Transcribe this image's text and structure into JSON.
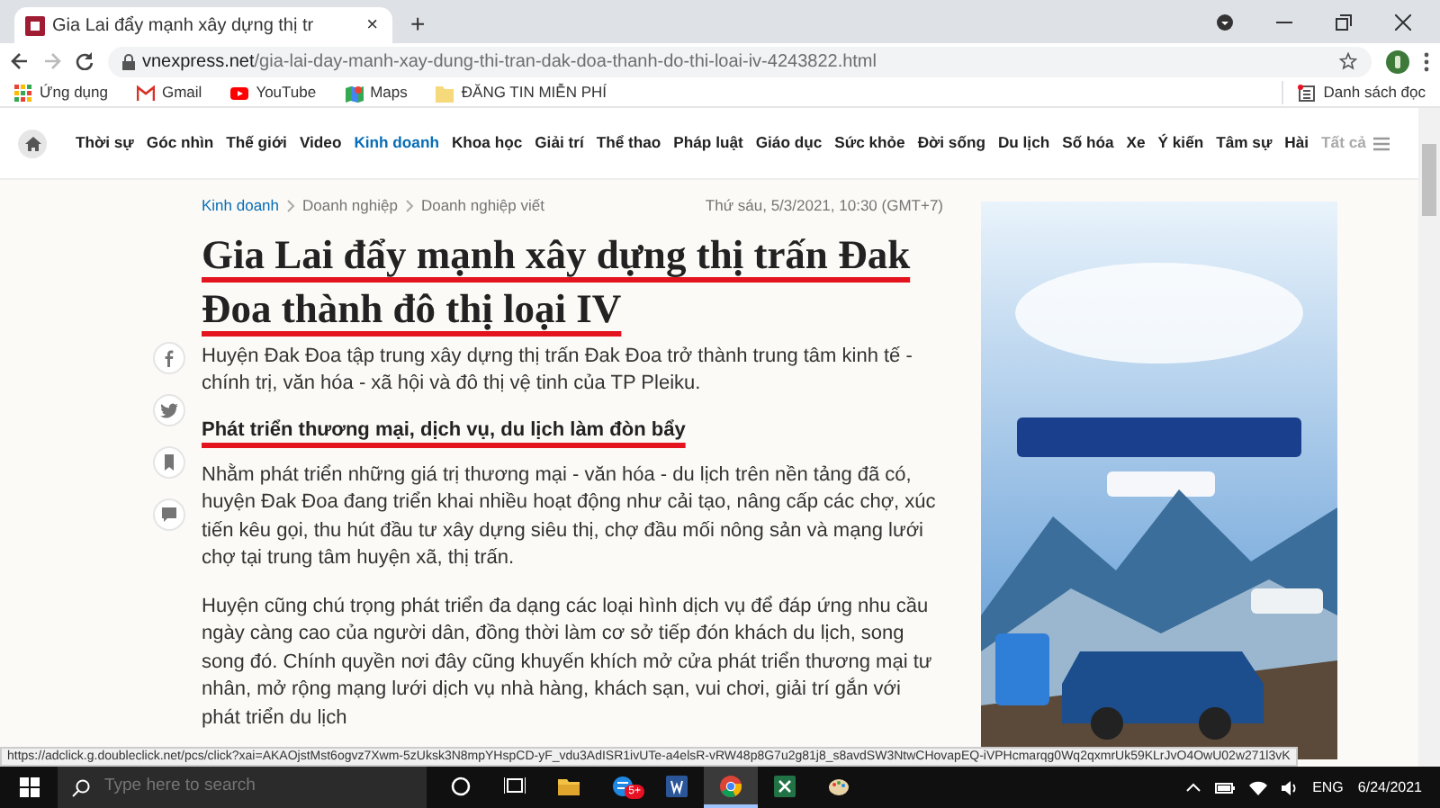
{
  "browser": {
    "tab": {
      "title": "Gia Lai đẩy mạnh xây dựng thị tr",
      "close": "×"
    },
    "new_tab": "+",
    "address": {
      "host": "vnexpress.net",
      "path": "/gia-lai-day-manh-xay-dung-thi-tran-dak-doa-thanh-do-thi-loai-iv-4243822.html"
    },
    "bookmarks": [
      {
        "label": "Ứng dụng",
        "kind": "apps"
      },
      {
        "label": "Gmail",
        "kind": "gmail"
      },
      {
        "label": "YouTube",
        "kind": "youtube"
      },
      {
        "label": "Maps",
        "kind": "maps"
      },
      {
        "label": "ĐĂNG TIN MIỄN PHÍ",
        "kind": "folder"
      }
    ],
    "reading_list": "Danh sách đọc"
  },
  "nav": {
    "items": [
      {
        "label": "Thời sự",
        "selected": false
      },
      {
        "label": "Góc nhìn",
        "selected": false
      },
      {
        "label": "Thế giới",
        "selected": false
      },
      {
        "label": "Video",
        "selected": false
      },
      {
        "label": "Kinh doanh",
        "selected": true
      },
      {
        "label": "Khoa học",
        "selected": false
      },
      {
        "label": "Giải trí",
        "selected": false
      },
      {
        "label": "Thể thao",
        "selected": false
      },
      {
        "label": "Pháp luật",
        "selected": false
      },
      {
        "label": "Giáo dục",
        "selected": false
      },
      {
        "label": "Sức khỏe",
        "selected": false
      },
      {
        "label": "Đời sống",
        "selected": false
      },
      {
        "label": "Du lịch",
        "selected": false
      },
      {
        "label": "Số hóa",
        "selected": false
      },
      {
        "label": "Xe",
        "selected": false
      },
      {
        "label": "Ý kiến",
        "selected": false
      },
      {
        "label": "Tâm sự",
        "selected": false
      },
      {
        "label": "Hài",
        "selected": false
      }
    ],
    "more": "Tất cả"
  },
  "article": {
    "breadcrumbs": [
      "Kinh doanh",
      "Doanh nghiệp",
      "Doanh nghiệp viết"
    ],
    "date": "Thứ sáu, 5/3/2021, 10:30 (GMT+7)",
    "title": "Gia Lai đẩy mạnh xây dựng thị trấn Đak Đoa thành đô thị loại IV",
    "title_annotated": true,
    "summary": "Huyện Đak Đoa tập trung xây dựng thị trấn Đak Đoa trở thành trung tâm kinh tế - chính trị, văn hóa - xã hội và đô thị vệ tinh của TP Pleiku.",
    "sections": [
      {
        "kind": "heading",
        "text": "Phát triển thương mại, dịch vụ, du lịch làm đòn bẩy",
        "annotated": true
      },
      {
        "kind": "paragraph",
        "text": "Nhằm phát triển những giá trị thương mại - văn hóa - du lịch trên nền tảng đã có, huyện Đak Đoa đang triển khai nhiều hoạt động như cải tạo, nâng cấp các chợ, xúc tiến kêu gọi, thu hút đầu tư xây dựng siêu thị, chợ đầu mối nông sản và mạng lưới chợ tại trung tâm huyện xã, thị trấn.",
        "annotated": false
      },
      {
        "kind": "paragraph",
        "text": "Huyện cũng chú trọng phát triển đa dạng các loại hình dịch vụ để đáp ứng nhu cầu ngày càng cao của người dân, đồng thời làm cơ sở tiếp đón khách du lịch, song song đó. Chính quyền nơi đây cũng khuyến khích mở cửa phát triển thương mại tư nhân, mở rộng mạng lưới dịch vụ nhà hàng, khách sạn, vui chơi, giải trí gắn với phát triển du lịch",
        "annotated": false
      }
    ],
    "share": [
      {
        "kind": "facebook"
      },
      {
        "kind": "twitter"
      },
      {
        "kind": "bookmark"
      },
      {
        "kind": "comment"
      }
    ],
    "ad": {
      "kind": "picture"
    }
  },
  "status_url": "https://adclick.g.doubleclick.net/pcs/click?xai=AKAOjstMst6ogvz7Xwm-5zUksk3N8mpYHspCD-yF_vdu3AdISR1ivUTe-a4elsR-vRW48p8G7u2g81j8_s8avdSW3NtwCHovapEQ-iVPHcmarqg0Wq2qxmrUk59KLrJvO4OwU02w271l3vK",
  "taskbar": {
    "search_placeholder": "Type here to search",
    "apps": [
      {
        "kind": "cortana",
        "selected": false
      },
      {
        "kind": "task-view",
        "selected": false
      },
      {
        "kind": "explorer",
        "selected": false
      },
      {
        "kind": "chat",
        "badge": "5+",
        "selected": false
      },
      {
        "kind": "word",
        "selected": false
      },
      {
        "kind": "chrome",
        "selected": true
      },
      {
        "kind": "excel",
        "selected": false
      },
      {
        "kind": "paint",
        "selected": false
      }
    ],
    "language": "ENG",
    "date": "6/24/2021"
  }
}
